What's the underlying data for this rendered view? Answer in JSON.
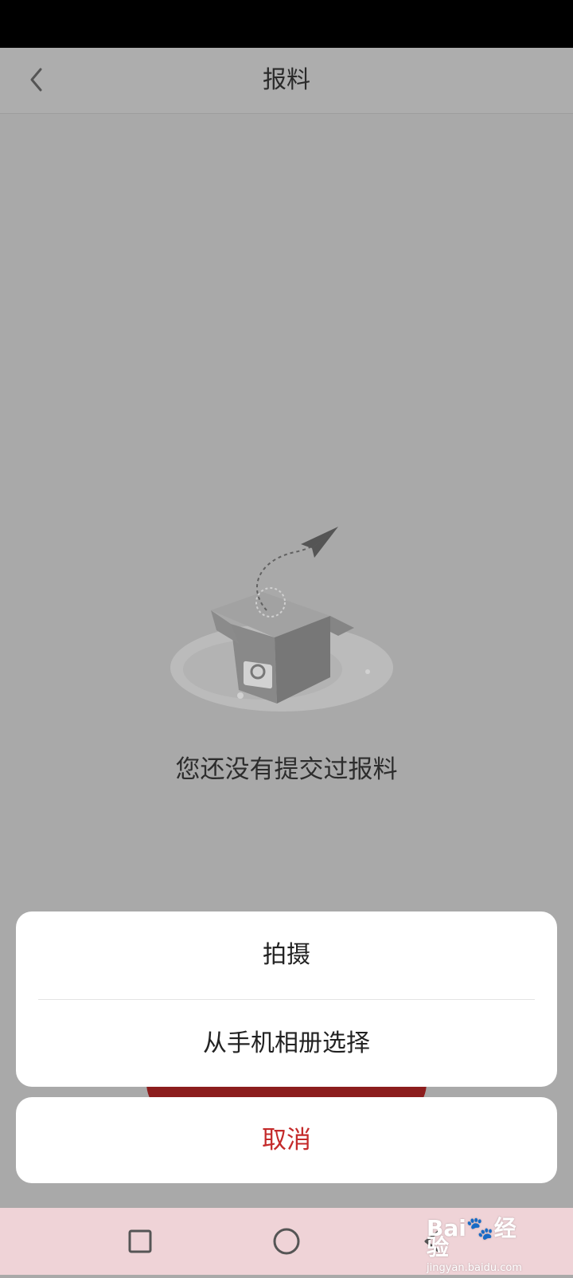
{
  "header": {
    "title": "报料",
    "back_icon": "chevron-left-icon"
  },
  "empty_state": {
    "illustration": "open-box-with-paper-plane",
    "message": "您还没有提交过报料"
  },
  "action_sheet": {
    "options": [
      "拍摄",
      "从手机相册选择"
    ],
    "cancel_label": "取消"
  },
  "navigation": {
    "icons": [
      "recent-apps-icon",
      "home-icon",
      "back-icon"
    ]
  },
  "watermark": {
    "brand": "Bai",
    "brand_suffix": "经验",
    "url": "jingyan.baidu.com"
  },
  "colors": {
    "overlay_background": "#a9a9a9",
    "cancel_text": "#c42a2a",
    "navigation_bar": "#efd3d7"
  }
}
